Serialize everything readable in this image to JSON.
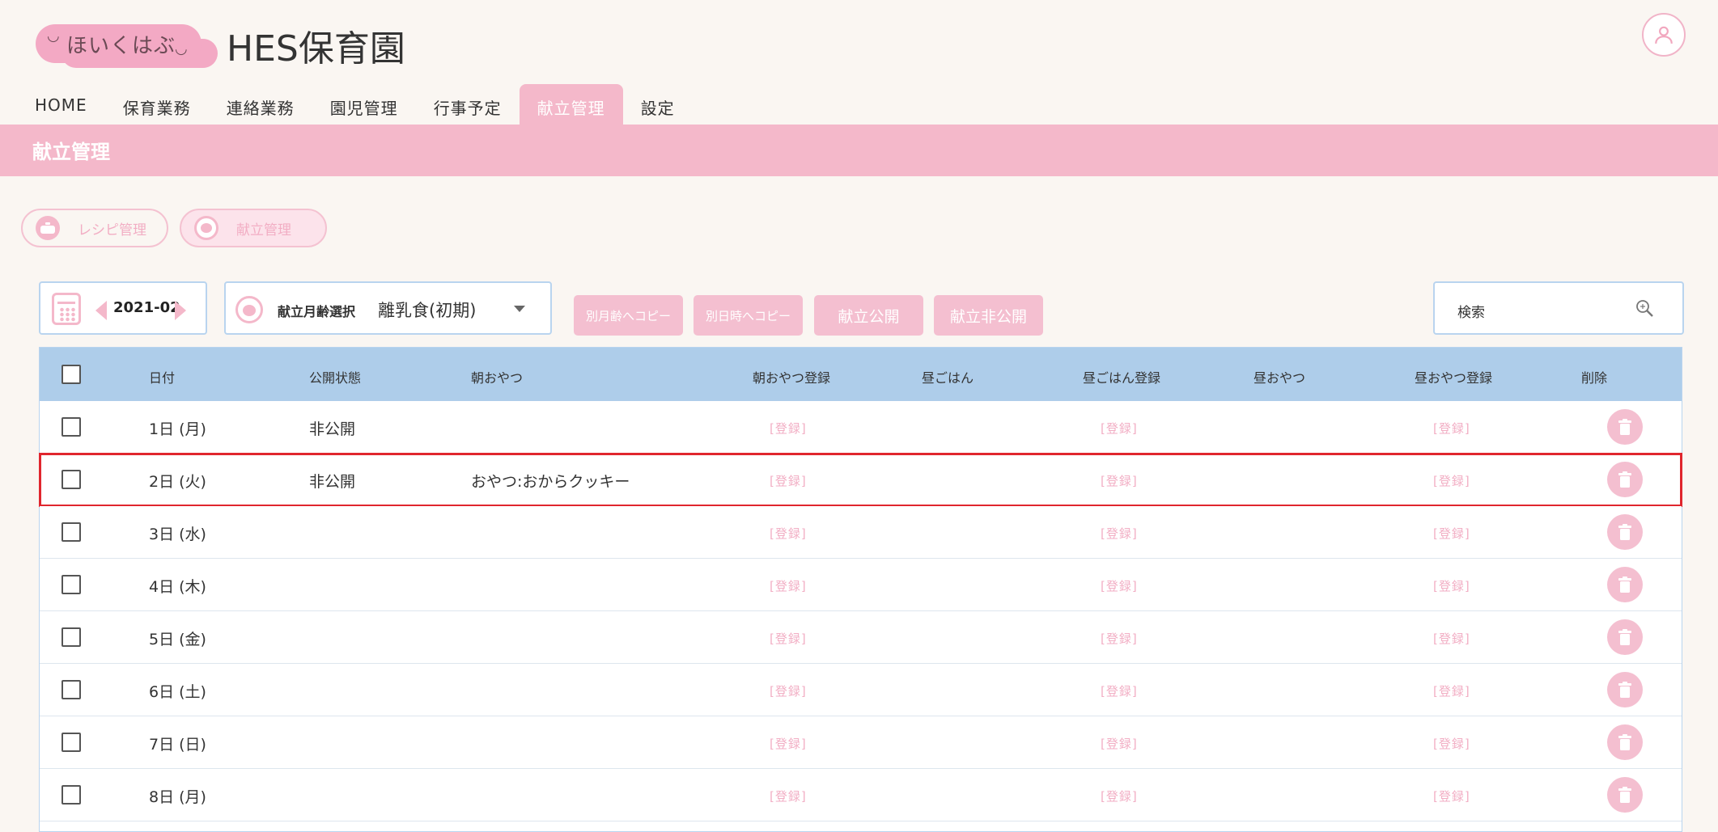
{
  "header": {
    "logo_text": "ほいくはぶ",
    "app_title": "HES保育園"
  },
  "nav": [
    {
      "label": "HOME"
    },
    {
      "label": "保育業務"
    },
    {
      "label": "連絡業務"
    },
    {
      "label": "園児管理"
    },
    {
      "label": "行事予定"
    },
    {
      "label": "献立管理",
      "active": true
    },
    {
      "label": "設定"
    }
  ],
  "page": {
    "title": "献立管理"
  },
  "subnav": {
    "recipe_label": "レシピ管理",
    "menu_label": "献立管理"
  },
  "controls": {
    "month": "2021-02",
    "age_label": "献立月齢選択",
    "age_value": "離乳食(初期)",
    "copy_age_label": "別月齢へコピー",
    "copy_date_label": "別日時へコピー",
    "publish_label": "献立公開",
    "unpublish_label": "献立非公開",
    "search_label": "検索"
  },
  "table": {
    "headers": {
      "date": "日付",
      "status": "公開状態",
      "morning_snack": "朝おやつ",
      "morning_snack_reg": "朝おやつ登録",
      "lunch": "昼ごはん",
      "lunch_reg": "昼ごはん登録",
      "afternoon_snack": "昼おやつ",
      "afternoon_snack_reg": "昼おやつ登録",
      "delete": "削除"
    },
    "register_label": "[登録]",
    "rows": [
      {
        "date": "1日 (月)",
        "status": "非公開",
        "morning_snack": "",
        "lunch": "",
        "afternoon_snack": ""
      },
      {
        "date": "2日 (火)",
        "status": "非公開",
        "morning_snack": "おやつ:おからクッキー",
        "lunch": "",
        "afternoon_snack": "",
        "selected": true
      },
      {
        "date": "3日 (水)",
        "status": "",
        "morning_snack": "",
        "lunch": "",
        "afternoon_snack": ""
      },
      {
        "date": "4日 (木)",
        "status": "",
        "morning_snack": "",
        "lunch": "",
        "afternoon_snack": ""
      },
      {
        "date": "5日 (金)",
        "status": "",
        "morning_snack": "",
        "lunch": "",
        "afternoon_snack": ""
      },
      {
        "date": "6日 (土)",
        "status": "",
        "morning_snack": "",
        "lunch": "",
        "afternoon_snack": ""
      },
      {
        "date": "7日 (日)",
        "status": "",
        "morning_snack": "",
        "lunch": "",
        "afternoon_snack": ""
      },
      {
        "date": "8日 (月)",
        "status": "",
        "morning_snack": "",
        "lunch": "",
        "afternoon_snack": ""
      }
    ]
  },
  "colors": {
    "accent_pink": "#f4b8ca",
    "header_blue": "#aecdea",
    "selection_red": "#e0262e"
  }
}
